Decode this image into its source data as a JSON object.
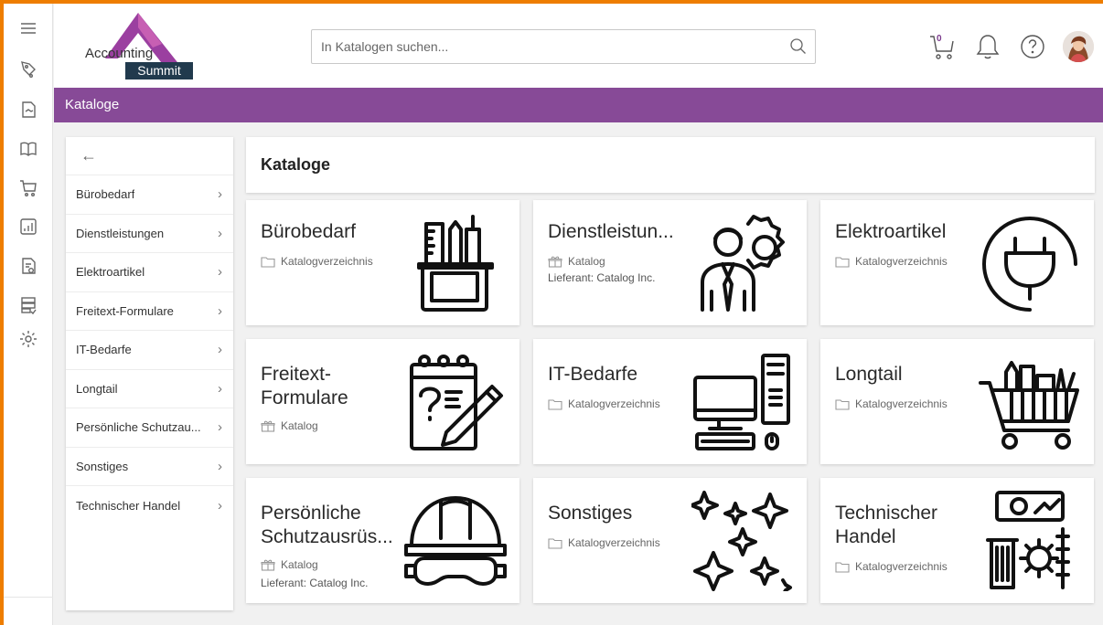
{
  "colors": {
    "accent_purple": "#874a97",
    "frame_orange": "#ee7d00",
    "logo_navy": "#213a4d"
  },
  "logo": {
    "line1": "Accounting",
    "line2": "Summit"
  },
  "search": {
    "placeholder": "In Katalogen suchen..."
  },
  "header": {
    "cart_count": "0",
    "icons": [
      "cart-icon",
      "bell-icon",
      "help-icon",
      "avatar"
    ]
  },
  "rail": {
    "icons": [
      "menu-icon",
      "shopping-tag-icon",
      "handshake-document-icon",
      "catalog-book-icon",
      "shopping-cart-icon",
      "analytics-chart-icon",
      "invoice-icon",
      "server-check-icon",
      "settings-icon"
    ]
  },
  "page_bar": {
    "title": "Kataloge"
  },
  "sidebar": {
    "back": "←",
    "items": [
      {
        "label": "Bürobedarf"
      },
      {
        "label": "Dienstleistungen"
      },
      {
        "label": "Elektroartikel"
      },
      {
        "label": "Freitext-Formulare"
      },
      {
        "label": "IT-Bedarfe"
      },
      {
        "label": "Longtail"
      },
      {
        "label": "Persönliche Schutzau..."
      },
      {
        "label": "Sonstiges"
      },
      {
        "label": "Technischer Handel"
      }
    ]
  },
  "main": {
    "title": "Kataloge",
    "cards": [
      {
        "title": "Bürobedarf",
        "type": "Katalogverzeichnis",
        "type_icon": "folder-icon",
        "supplier": "",
        "art": "office-supplies-icon"
      },
      {
        "title": "Dienstleistun...",
        "type": "Katalog",
        "type_icon": "gift-icon",
        "supplier": "Lieferant: Catalog Inc.",
        "art": "service-person-gear-icon"
      },
      {
        "title": "Elektroartikel",
        "type": "Katalogverzeichnis",
        "type_icon": "folder-icon",
        "supplier": "",
        "art": "power-plug-icon"
      },
      {
        "title": "Freitext-\nFormulare",
        "type": "Katalog",
        "type_icon": "gift-icon",
        "supplier": "",
        "art": "form-pencil-icon"
      },
      {
        "title": "IT-Bedarfe",
        "type": "Katalogverzeichnis",
        "type_icon": "folder-icon",
        "supplier": "",
        "art": "computer-icon"
      },
      {
        "title": "Longtail",
        "type": "Katalogverzeichnis",
        "type_icon": "folder-icon",
        "supplier": "",
        "art": "grocery-cart-icon"
      },
      {
        "title": "Persönliche\nSchutzausrüs...",
        "type": "Katalog",
        "type_icon": "gift-icon",
        "supplier": "Lieferant: Catalog Inc.",
        "art": "helmet-goggles-icon"
      },
      {
        "title": "Sonstiges",
        "type": "Katalogverzeichnis",
        "type_icon": "folder-icon",
        "supplier": "",
        "art": "sparkles-icon"
      },
      {
        "title": "Technischer\nHandel",
        "type": "Katalogverzeichnis",
        "type_icon": "folder-icon",
        "supplier": "",
        "art": "industrial-tools-icon"
      }
    ]
  }
}
